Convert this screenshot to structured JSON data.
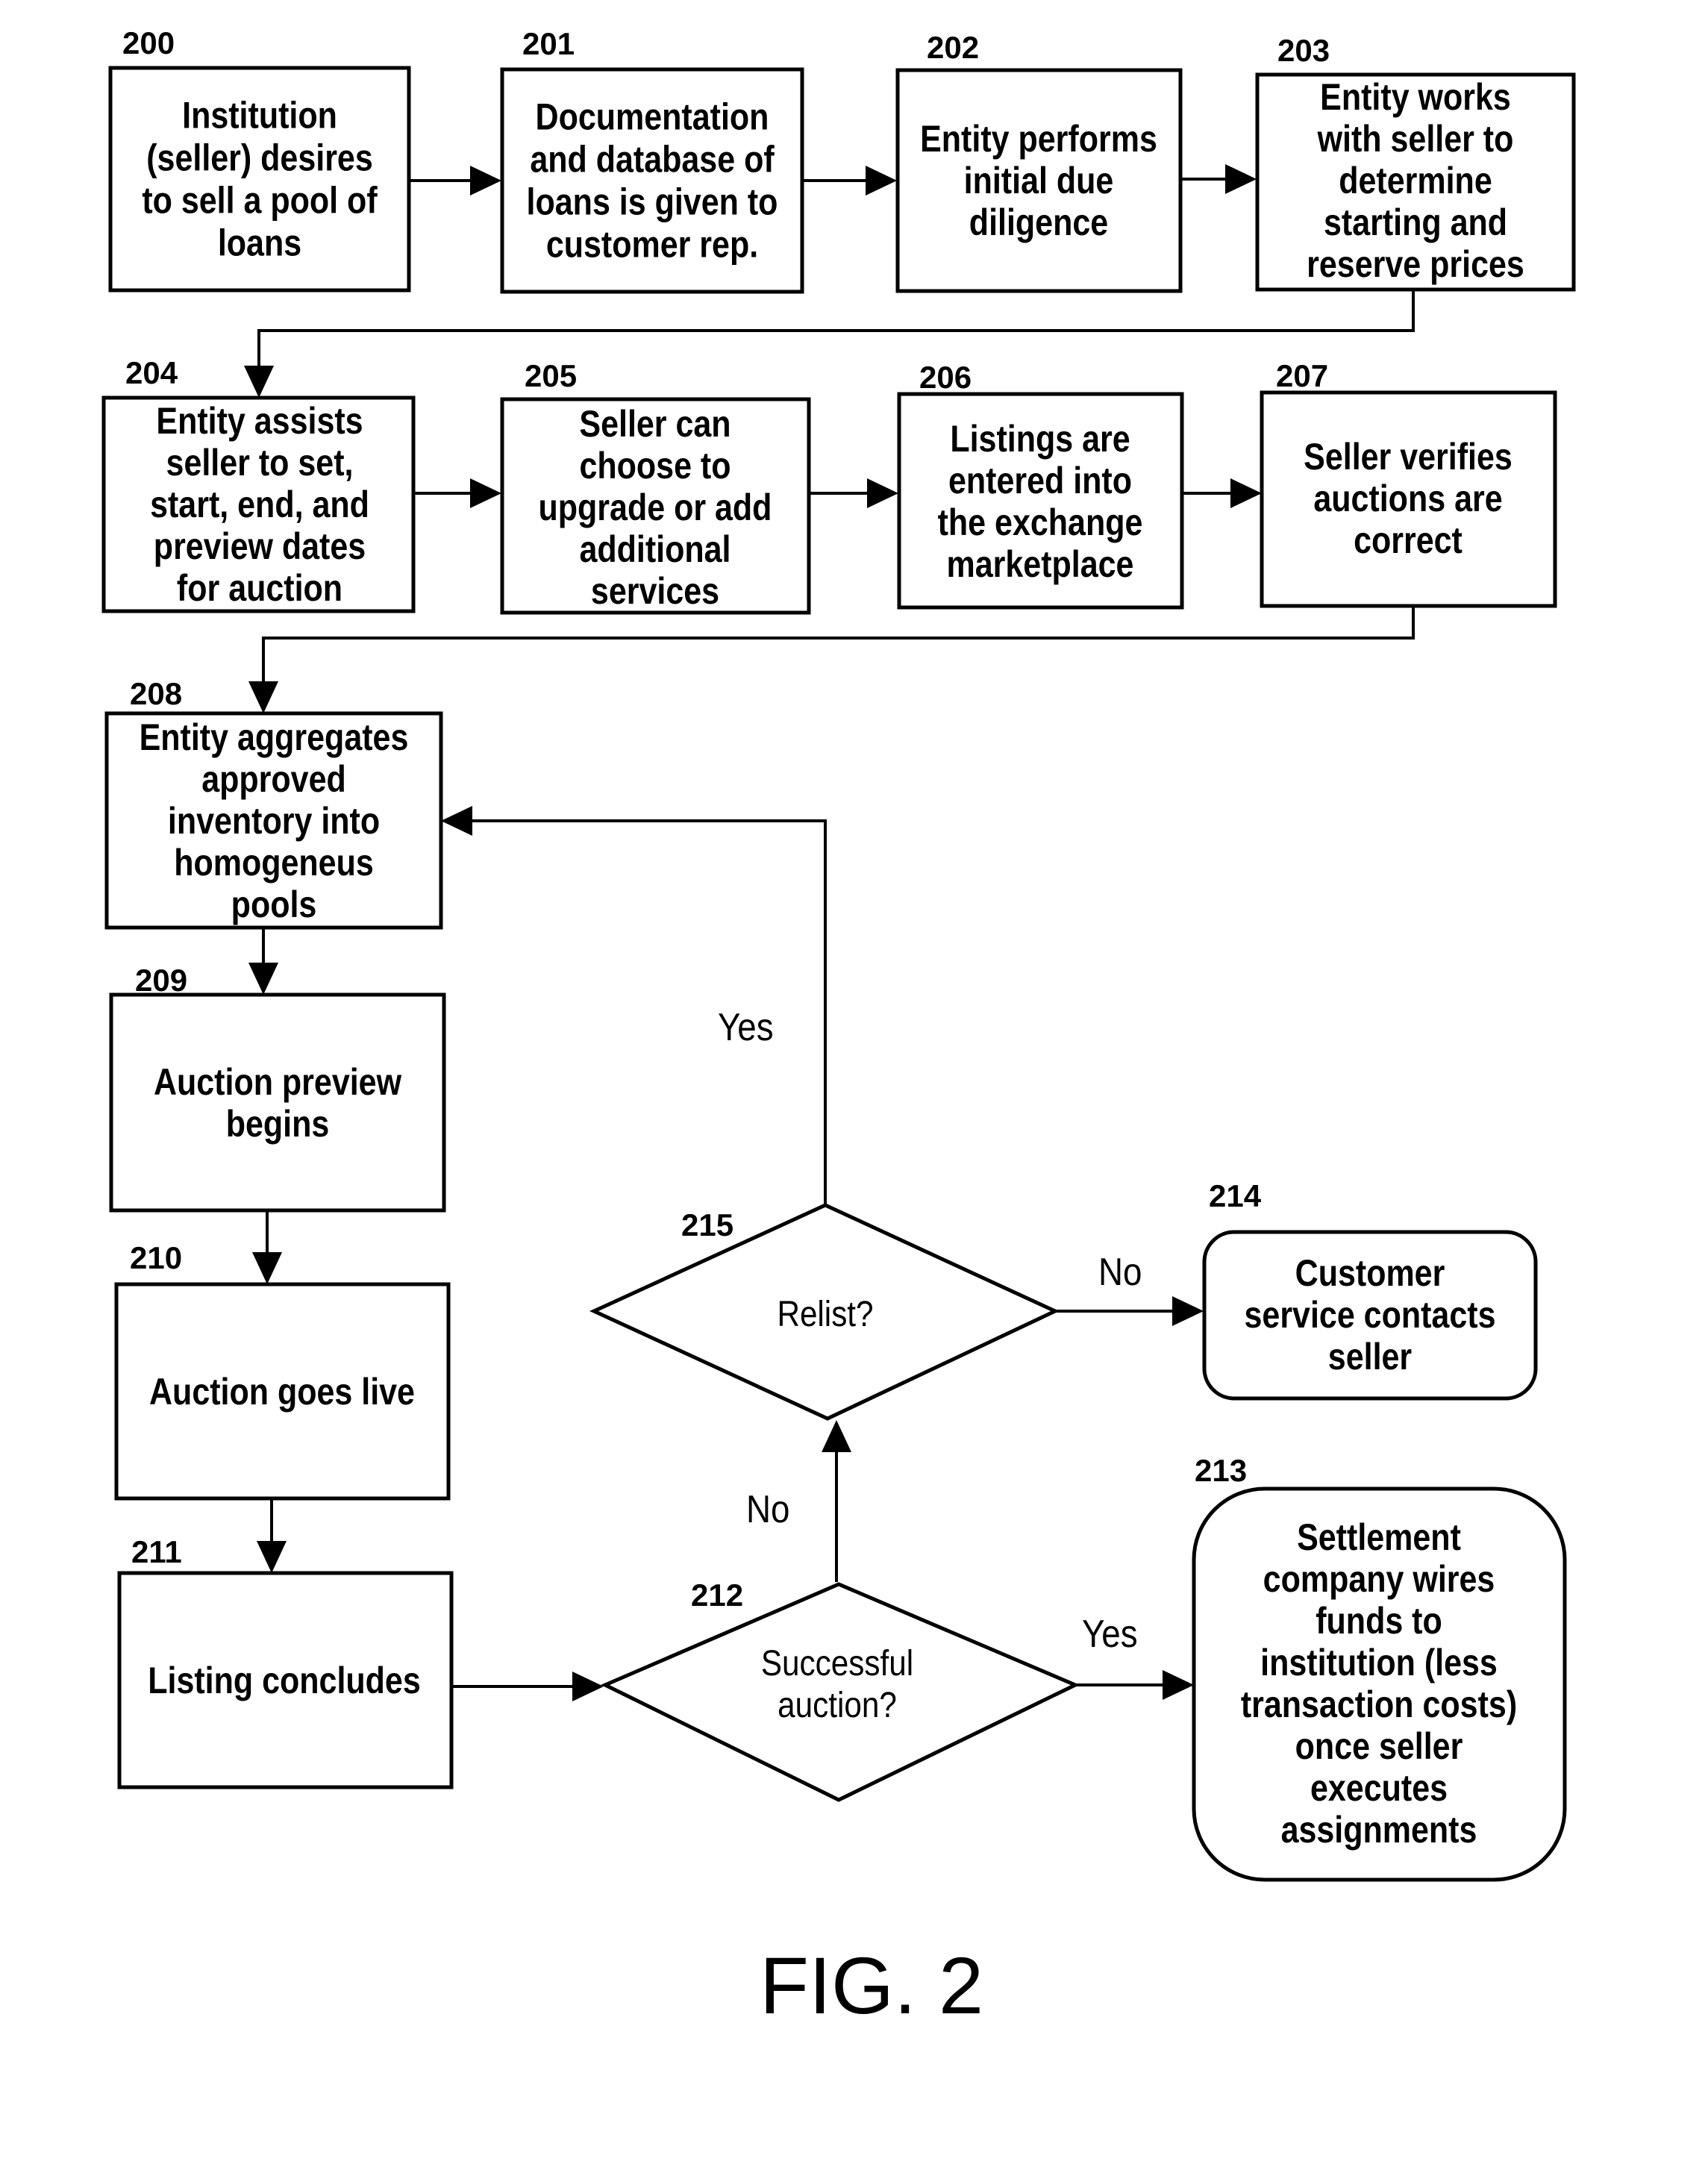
{
  "figure_label": "FIG. 2",
  "steps": [
    {
      "id": "200",
      "lines": [
        "Institution",
        "(seller) desires",
        "to sell a pool of",
        "loans"
      ]
    },
    {
      "id": "201",
      "lines": [
        "Documentation",
        "and database of",
        "loans is given to",
        "customer rep."
      ]
    },
    {
      "id": "202",
      "lines": [
        "Entity performs",
        "initial due",
        "diligence"
      ]
    },
    {
      "id": "203",
      "lines": [
        "Entity works",
        "with seller to",
        "determine",
        "starting and",
        "reserve prices"
      ]
    },
    {
      "id": "204",
      "lines": [
        "Entity assists",
        "seller to set,",
        "start, end, and",
        "preview dates",
        "for auction"
      ]
    },
    {
      "id": "205",
      "lines": [
        "Seller can",
        "choose to",
        "upgrade or add",
        "additional",
        "services"
      ]
    },
    {
      "id": "206",
      "lines": [
        "Listings are",
        "entered into",
        "the exchange",
        "marketplace"
      ]
    },
    {
      "id": "207",
      "lines": [
        "Seller verifies",
        "auctions are",
        "correct"
      ]
    },
    {
      "id": "208",
      "lines": [
        "Entity aggregates",
        "approved",
        "inventory into",
        "homogeneus",
        "pools"
      ]
    },
    {
      "id": "209",
      "lines": [
        "Auction preview",
        "begins"
      ]
    },
    {
      "id": "210",
      "lines": [
        "Auction goes live"
      ]
    },
    {
      "id": "211",
      "lines": [
        "Listing concludes"
      ]
    },
    {
      "id": "212",
      "lines": [
        "Successful",
        "auction?"
      ]
    },
    {
      "id": "213",
      "lines": [
        "Settlement",
        "company wires",
        "funds to",
        "institution (less",
        "transaction costs)",
        "once seller",
        "executes",
        "assignments"
      ]
    },
    {
      "id": "214",
      "lines": [
        "Customer",
        "service contacts",
        "seller"
      ]
    },
    {
      "id": "215",
      "lines": [
        "Relist?"
      ]
    }
  ],
  "edge_labels": {
    "relist_yes": "Yes",
    "relist_no": "No",
    "success_no": "No",
    "success_yes": "Yes"
  }
}
